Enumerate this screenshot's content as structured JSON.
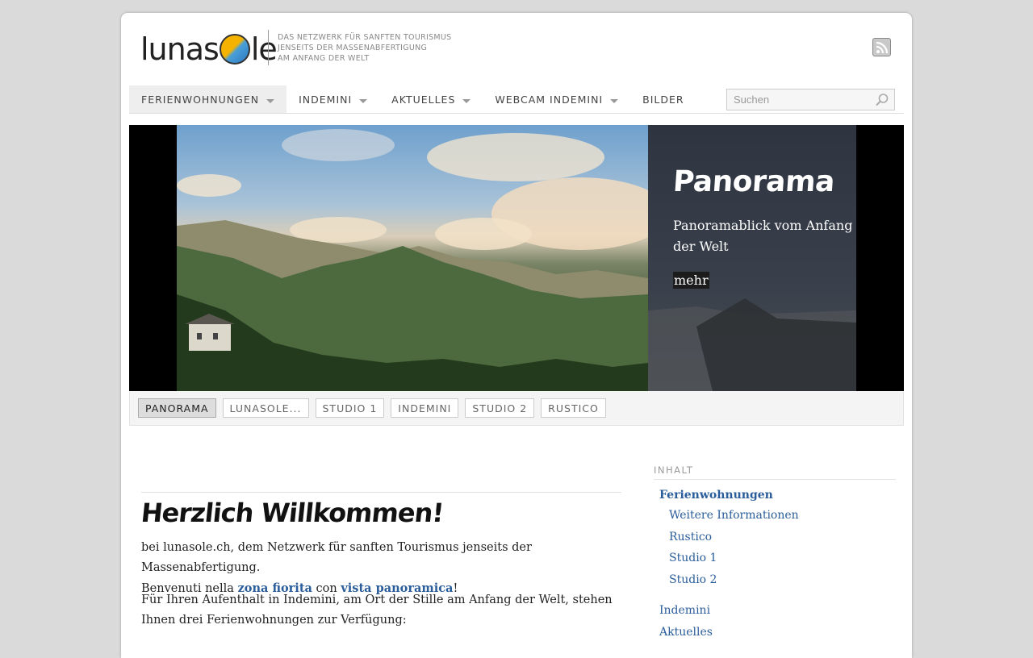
{
  "header": {
    "logo_text_start": "lunas",
    "logo_text_end": "le",
    "tagline": [
      "DAS NETZWERK FÜR SANFTEN TOURISMUS",
      "JENSEITS DER MASSENABFERTIGUNG",
      "AM ANFANG DER WELT"
    ]
  },
  "nav": {
    "items": [
      {
        "label": "FERIENWOHNUNGEN",
        "has_dropdown": true,
        "active": true
      },
      {
        "label": "INDEMINI",
        "has_dropdown": true
      },
      {
        "label": "AKTUELLES",
        "has_dropdown": true
      },
      {
        "label": "WEBCAM INDEMINI",
        "has_dropdown": true
      },
      {
        "label": "BILDER",
        "has_dropdown": false
      }
    ],
    "search_placeholder": "Suchen"
  },
  "slider": {
    "title": "Panorama",
    "text": "Panoramablick vom Anfang der Welt",
    "more": "mehr",
    "tabs": [
      "PANORAMA",
      "LUNASOLE...",
      "STUDIO 1",
      "INDEMINI",
      "STUDIO 2",
      "RUSTICO"
    ],
    "active_tab": 0
  },
  "main": {
    "heading": "Herzlich Willkommen!",
    "p1_line1": "bei lunasole.ch, dem Netzwerk für sanften Tourismus jenseits der Massenabfertigung.",
    "p1_pre": "Benvenuti nella ",
    "p1_link1": "zona fiorita",
    "p1_mid": " con ",
    "p1_link2": "vista panoramica",
    "p1_end": "!",
    "p2": "Für Ihren Aufenthalt in Indemini, am Ort der Stille am Anfang der Welt, stehen Ihnen drei Ferienwohnungen zur Verfügung:"
  },
  "sidebar": {
    "heading": "INHALT",
    "links": [
      {
        "label": "Ferienwohnungen",
        "bold": true
      },
      {
        "label": "Weitere Informationen"
      },
      {
        "label": "Rustico"
      },
      {
        "label": "Studio 1"
      },
      {
        "label": "Studio 2"
      },
      {
        "label": "Indemini"
      },
      {
        "label": "Aktuelles"
      }
    ]
  },
  "colors": {
    "link": "#2a5d9a",
    "page_bg": "#dadada"
  }
}
